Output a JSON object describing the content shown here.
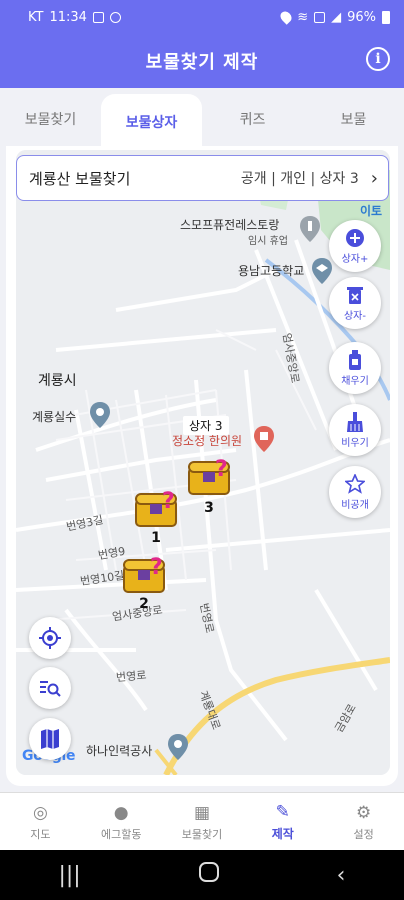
{
  "status_bar": {
    "carrier": "KT",
    "time": "11:34",
    "battery": "96%"
  },
  "header": {
    "title": "보물찾기 제작",
    "info_icon": "i"
  },
  "tabs": [
    {
      "label": "보물찾기",
      "active": false
    },
    {
      "label": "보물상자",
      "active": true
    },
    {
      "label": "퀴즈",
      "active": false
    },
    {
      "label": "보물",
      "active": false
    }
  ],
  "selector": {
    "name": "계룡산 보물찾기",
    "meta": "공개 | 개인 | 상자 3",
    "chevron": "›"
  },
  "side_buttons": [
    {
      "label": "상자+",
      "icon": "plus-circle-icon",
      "glyph": "+"
    },
    {
      "label": "상자-",
      "icon": "trash-icon",
      "glyph": "🗑"
    },
    {
      "label": "채우기",
      "icon": "bottle-icon",
      "glyph": "▮"
    },
    {
      "label": "비우기",
      "icon": "broom-icon",
      "glyph": "⌂"
    },
    {
      "label": "비공개",
      "icon": "star-icon",
      "glyph": "☆"
    }
  ],
  "map_labels": {
    "city": "계룡시",
    "poi_1": "계룡실수",
    "poi_2": "정소정 한의원",
    "poi_3": "스모프퓨전레스토랑",
    "poi_3_sub": "임시 휴업",
    "poi_4": "용남고등학교",
    "poi_5": "하나인력공사",
    "poi_6": "이토",
    "street_1": "번영3길",
    "street_2": "번영9",
    "street_3": "번영10길",
    "street_4": "엄사중앙로",
    "street_5": "엄사중앙로",
    "street_6": "번영로",
    "street_7": "금암로",
    "street_8": "계룡대로",
    "street_9": "번영로"
  },
  "tooltip": "상자 3",
  "chests": [
    {
      "num": "1"
    },
    {
      "num": "2"
    },
    {
      "num": "3"
    }
  ],
  "google": "Google",
  "bottom_nav": [
    {
      "label": "지도",
      "icon": "map-search-icon",
      "glyph": "◎",
      "active": false
    },
    {
      "label": "에그할동",
      "icon": "egg-icon",
      "glyph": "●",
      "active": false
    },
    {
      "label": "보물찾기",
      "icon": "grid-icon",
      "glyph": "▦",
      "active": false
    },
    {
      "label": "제작",
      "icon": "edit-icon",
      "glyph": "✎",
      "active": true
    },
    {
      "label": "설정",
      "icon": "gear-icon",
      "glyph": "⚙",
      "active": false
    }
  ],
  "colors": {
    "primary": "#6b6ef0",
    "accent": "#4b4fd8",
    "chest_gold": "#e8b21a",
    "question_pink": "#e0288a"
  }
}
